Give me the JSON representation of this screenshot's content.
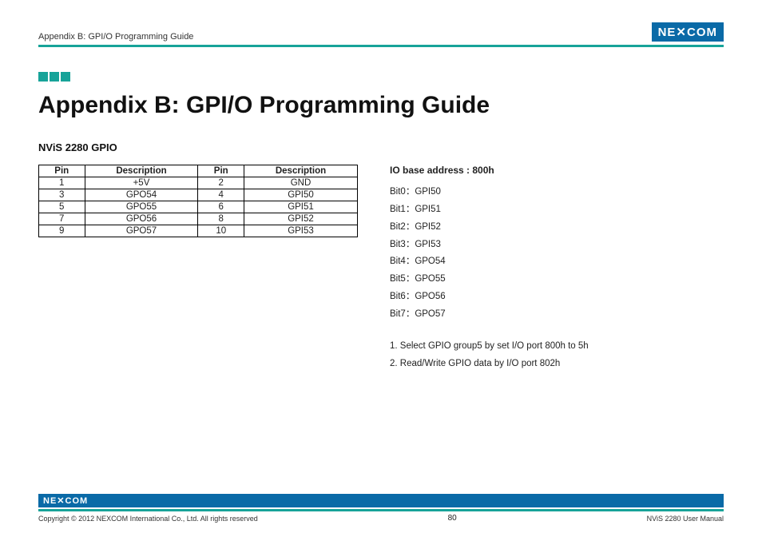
{
  "header": {
    "breadcrumb": "Appendix B: GPI/O Programming Guide",
    "logo_text": "NE✕COM"
  },
  "title": "Appendix B: GPI/O Programming Guide",
  "subhead": "NViS 2280 GPIO",
  "table": {
    "headers": [
      "Pin",
      "Description",
      "Pin",
      "Description"
    ],
    "rows": [
      [
        "1",
        "+5V",
        "2",
        "GND"
      ],
      [
        "3",
        "GPO54",
        "4",
        "GPI50"
      ],
      [
        "5",
        "GPO55",
        "6",
        "GPI51"
      ],
      [
        "7",
        "GPO56",
        "8",
        "GPI52"
      ],
      [
        "9",
        "GPO57",
        "10",
        "GPI53"
      ]
    ]
  },
  "io": {
    "heading": "IO base address : 800h",
    "bits": [
      "Bit0：GPI50",
      "Bit1：GPI51",
      "Bit2：GPI52",
      "Bit3：GPI53",
      "Bit4：GPO54",
      "Bit5：GPO55",
      "Bit6：GPO56",
      "Bit7：GPO57"
    ],
    "steps": [
      "1. Select GPIO group5 by set I/O port 800h to 5h",
      "2. Read/Write GPIO data by I/O port 802h"
    ]
  },
  "footer": {
    "logo_text": "NE✕COM",
    "copyright": "Copyright © 2012 NEXCOM International Co., Ltd. All rights reserved",
    "page": "80",
    "doc": "NViS 2280 User Manual"
  }
}
